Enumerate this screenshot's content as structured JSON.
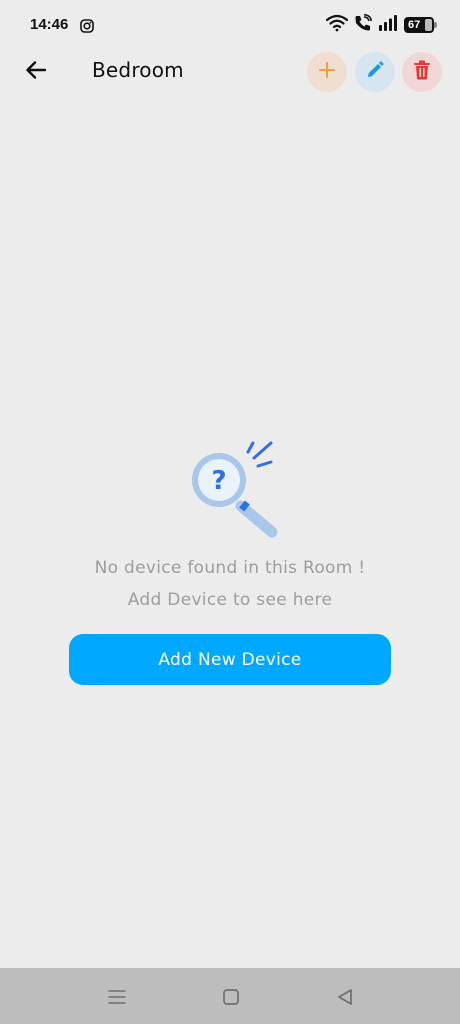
{
  "status_bar": {
    "time": "14:46",
    "battery_level": "67",
    "icons": [
      "instagram-icon",
      "wifi-icon",
      "wifi-call-icon",
      "signal-icon",
      "battery-icon"
    ]
  },
  "app_bar": {
    "title": "Bedroom",
    "back_icon": "arrow-left-icon",
    "actions": [
      {
        "name": "add",
        "icon": "plus-icon",
        "color": "#f59f2c",
        "background": "#f0dfd0"
      },
      {
        "name": "edit",
        "icon": "pencil-icon",
        "color": "#1a9be0",
        "background": "#d6e5ef"
      },
      {
        "name": "delete",
        "icon": "trash-icon",
        "color": "#e53935",
        "background": "#f0d6d6"
      }
    ]
  },
  "empty_state": {
    "illustration": "magnifier-question-icon",
    "title": "No device found in this Room !",
    "subtitle": "Add Device to see here",
    "button_label": "Add New Device"
  },
  "colors": {
    "background": "#ececec",
    "accent": "#00a8ff",
    "muted_text": "#9d9d9d",
    "nav_bar": "#bdbdbd"
  },
  "nav_bar": {
    "icons": [
      "menu-icon",
      "home-icon",
      "back-triangle-icon"
    ]
  }
}
